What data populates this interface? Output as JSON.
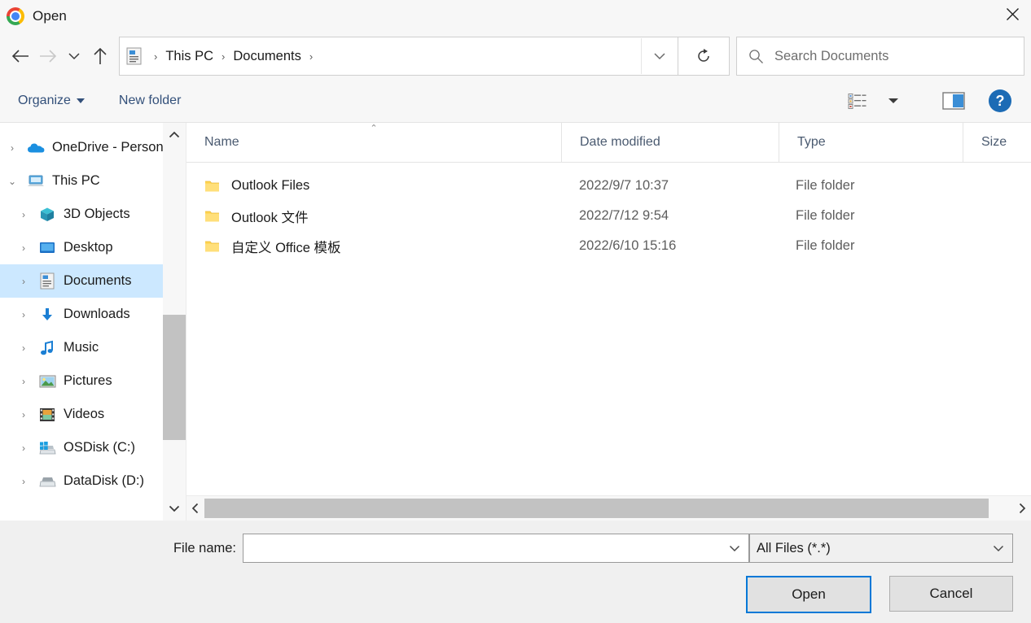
{
  "window": {
    "title": "Open",
    "app_icon": "chrome-logo-icon",
    "close_label": "✕"
  },
  "nav": {
    "back": "←",
    "forward": "→",
    "recent": "⌄",
    "up": "↑",
    "refresh": "↻",
    "address_icon": "documents-folder-icon",
    "breadcrumbs": [
      "This PC",
      "Documents"
    ],
    "breadcrumb_separator": "›",
    "address_dropdown": "⌄"
  },
  "search": {
    "placeholder": "Search Documents",
    "value": "",
    "icon": "search-icon"
  },
  "toolbar": {
    "organize_label": "Organize",
    "new_folder_label": "New folder",
    "view_icon": "view-list-icon",
    "view_dropdown_icon": "chevron-down-icon",
    "preview_pane_icon": "preview-pane-icon",
    "help_label": "?"
  },
  "sidebar": {
    "items": [
      {
        "label": "OneDrive - Person",
        "icon": "onedrive-cloud-icon",
        "level": 0,
        "expander": "›",
        "selected": false
      },
      {
        "label": "This PC",
        "icon": "this-pc-icon",
        "level": 0,
        "expander": "⌄",
        "selected": false
      },
      {
        "label": "3D Objects",
        "icon": "3d-objects-icon",
        "level": 1,
        "expander": "›",
        "selected": false
      },
      {
        "label": "Desktop",
        "icon": "desktop-icon",
        "level": 1,
        "expander": "›",
        "selected": false
      },
      {
        "label": "Documents",
        "icon": "documents-icon",
        "level": 1,
        "expander": "›",
        "selected": true
      },
      {
        "label": "Downloads",
        "icon": "downloads-icon",
        "level": 1,
        "expander": "›",
        "selected": false
      },
      {
        "label": "Music",
        "icon": "music-icon",
        "level": 1,
        "expander": "›",
        "selected": false
      },
      {
        "label": "Pictures",
        "icon": "pictures-icon",
        "level": 1,
        "expander": "›",
        "selected": false
      },
      {
        "label": "Videos",
        "icon": "videos-icon",
        "level": 1,
        "expander": "›",
        "selected": false
      },
      {
        "label": "OSDisk (C:)",
        "icon": "windows-drive-icon",
        "level": 1,
        "expander": "›",
        "selected": false
      },
      {
        "label": "DataDisk (D:)",
        "icon": "drive-icon",
        "level": 1,
        "expander": "›",
        "selected": false
      }
    ],
    "scroll_up": "⌃",
    "scroll_down": "⌄"
  },
  "file_list": {
    "columns": [
      "Name",
      "Date modified",
      "Type",
      "Size"
    ],
    "sort_column": "Name",
    "sort_indicator": "⌃",
    "rows": [
      {
        "name": "Outlook Files",
        "date_modified": "2022/9/7 10:37",
        "type": "File folder",
        "size": "",
        "icon": "folder-icon"
      },
      {
        "name": "Outlook 文件",
        "date_modified": "2022/7/12 9:54",
        "type": "File folder",
        "size": "",
        "icon": "folder-icon"
      },
      {
        "name": "自定义 Office 模板",
        "date_modified": "2022/6/10 15:16",
        "type": "File folder",
        "size": "",
        "icon": "folder-icon"
      }
    ],
    "scroll_left": "‹",
    "scroll_right": "›"
  },
  "footer": {
    "filename_label": "File name:",
    "filename_value": "",
    "filename_placeholder": "",
    "filename_dropdown": "⌄",
    "filter_value": "All Files (*.*)",
    "filter_dropdown": "⌄",
    "open_label": "Open",
    "cancel_label": "Cancel"
  },
  "colors": {
    "accent": "#0078d7",
    "selection": "#cce8ff",
    "folder": "#ffd95e",
    "link_text": "#33507a"
  }
}
